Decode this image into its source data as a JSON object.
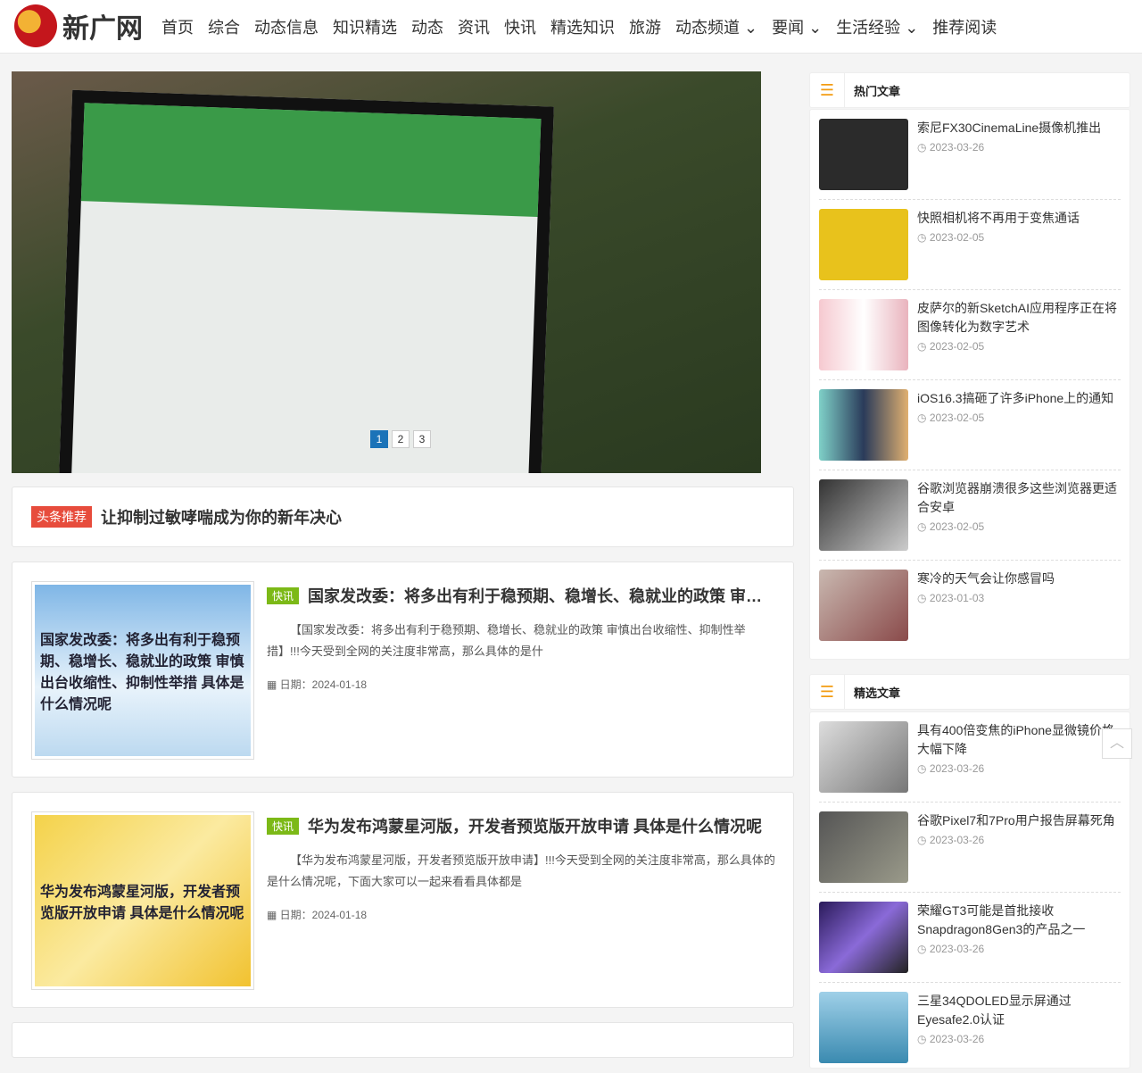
{
  "site": {
    "logo_text": "新广网"
  },
  "nav": [
    "首页",
    "综合",
    "动态信息",
    "知识精选",
    "动态",
    "资讯",
    "快讯",
    "精选知识",
    "旅游",
    "动态频道 ⌄",
    "要闻 ⌄",
    "生活经验 ⌄",
    "推荐阅读"
  ],
  "carousel": {
    "pages": [
      "1",
      "2",
      "3"
    ],
    "active": 1
  },
  "headline": {
    "tag": "头条推荐",
    "title": "让抑制过敏哮喘成为你的新年决心"
  },
  "articles": [
    {
      "thumb_text": "国家发改委：将多出有利于稳预期、稳增长、稳就业的政策 审慎出台收缩性、抑制性举措 具体是什么情况呢",
      "tag": "快讯",
      "title": "国家发改委：将多出有利于稳预期、稳增长、稳就业的政策 审慎出台收缩性、抑制性举措 具体是什么情况呢",
      "desc": "【国家发改委：将多出有利于稳预期、稳增长、稳就业的政策 审慎出台收缩性、抑制性举措】!!!今天受到全网的关注度非常高，那么具体的是什",
      "date": "日期：2024-01-18"
    },
    {
      "thumb_text": "华为发布鸿蒙星河版，开发者预览版开放申请 具体是什么情况呢",
      "tag": "快讯",
      "title": "华为发布鸿蒙星河版，开发者预览版开放申请 具体是什么情况呢",
      "desc": "【华为发布鸿蒙星河版，开发者预览版开放申请】!!!今天受到全网的关注度非常高，那么具体的是什么情况呢，下面大家可以一起来看看具体都是",
      "date": "日期：2024-01-18"
    }
  ],
  "hot": {
    "title": "热门文章",
    "items": [
      {
        "title": "索尼FX30CinemaLine摄像机推出",
        "date": "2023-03-26"
      },
      {
        "title": "快照相机将不再用于变焦通话",
        "date": "2023-02-05"
      },
      {
        "title": "皮萨尔的新SketchAI应用程序正在将图像转化为数字艺术",
        "date": "2023-02-05"
      },
      {
        "title": "iOS16.3搞砸了许多iPhone上的通知",
        "date": "2023-02-05"
      },
      {
        "title": "谷歌浏览器崩溃很多这些浏览器更适合安卓",
        "date": "2023-02-05"
      },
      {
        "title": "寒冷的天气会让你感冒吗",
        "date": "2023-01-03"
      }
    ]
  },
  "featured": {
    "title": "精选文章",
    "items": [
      {
        "title": "具有400倍变焦的iPhone显微镜价格大幅下降",
        "date": "2023-03-26"
      },
      {
        "title": "谷歌Pixel7和7Pro用户报告屏幕死角",
        "date": "2023-03-26"
      },
      {
        "title": "荣耀GT3可能是首批接收Snapdragon8Gen3的产品之一",
        "date": "2023-03-26"
      },
      {
        "title": "三星34QDOLED显示屏通过Eyesafe2.0认证",
        "date": "2023-03-26"
      }
    ]
  },
  "colors": {
    "accent": "#f39c12",
    "tag_red": "#e74c3c",
    "tag_green": "#7cb917",
    "page_active": "#1b73b8"
  }
}
